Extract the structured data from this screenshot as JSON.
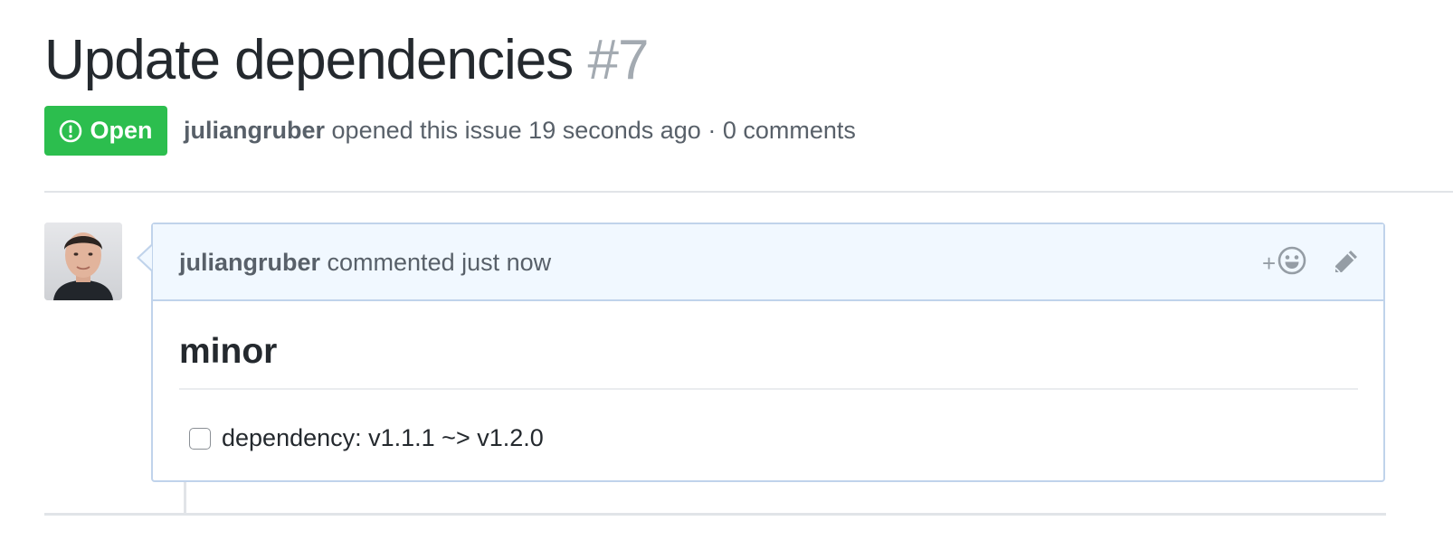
{
  "issue": {
    "title": "Update dependencies",
    "number": "#7",
    "state": "Open",
    "author": "juliangruber",
    "meta_text": "opened this issue 19 seconds ago · 0 comments"
  },
  "comment": {
    "author": "juliangruber",
    "action_text": "commented just now",
    "reaction_plus": "+",
    "heading": "minor",
    "task_item": "dependency: v1.1.1 ~> v1.2.0",
    "task_checked": false
  },
  "colors": {
    "open_green": "#2cbe4e",
    "comment_header_bg": "#f1f8ff",
    "comment_border": "#c0d3eb",
    "muted_text": "#586069",
    "number_gray": "#a3aab1"
  },
  "icons": {
    "state": "issue-opened-icon",
    "reaction": "smiley-icon",
    "edit": "pencil-icon"
  }
}
